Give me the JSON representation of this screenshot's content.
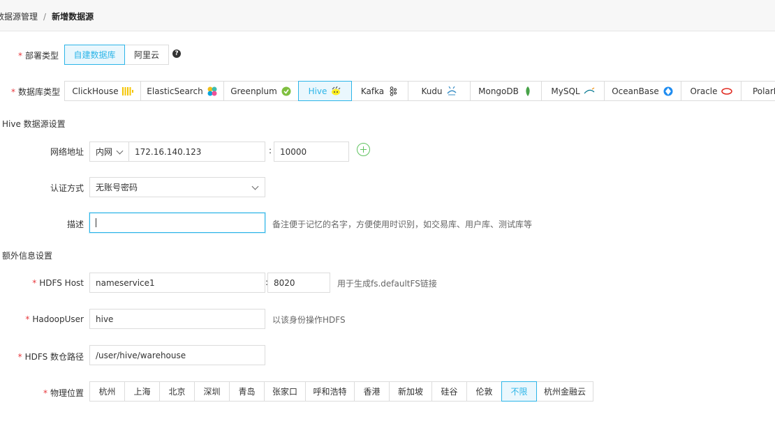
{
  "breadcrumb": {
    "parent": "数据源管理",
    "separator": "/",
    "current": "新增数据源"
  },
  "deploy_type": {
    "label": "部署类型",
    "options": [
      "自建数据库",
      "阿里云"
    ],
    "selected": "自建数据库",
    "help_icon": "question-circle-icon"
  },
  "db_type": {
    "label": "数据库类型",
    "options": [
      {
        "name": "ClickHouse",
        "icon": "clickhouse-icon"
      },
      {
        "name": "ElasticSearch",
        "icon": "elasticsearch-icon"
      },
      {
        "name": "Greenplum",
        "icon": "greenplum-icon"
      },
      {
        "name": "Hive",
        "icon": "hive-icon"
      },
      {
        "name": "Kafka",
        "icon": "kafka-icon"
      },
      {
        "name": "Kudu",
        "icon": "kudu-icon"
      },
      {
        "name": "MongoDB",
        "icon": "mongodb-icon"
      },
      {
        "name": "MySQL",
        "icon": "mysql-icon"
      },
      {
        "name": "OceanBase",
        "icon": "oceanbase-icon"
      },
      {
        "name": "Oracle",
        "icon": "oracle-icon"
      },
      {
        "name": "PolarDB-",
        "icon": ""
      }
    ],
    "selected": "Hive"
  },
  "hive_section": {
    "title": "Hive 数据源设置",
    "network": {
      "label": "网络地址",
      "type": "内网",
      "host": "172.16.140.123",
      "colon": ":",
      "port": "10000",
      "add_icon": "plus-circle-icon"
    },
    "auth": {
      "label": "认证方式",
      "value": "无账号密码"
    },
    "description": {
      "label": "描述",
      "value": "",
      "hint": "备注便于记忆的名字，方便使用时识别，如交易库、用户库、测试库等"
    }
  },
  "extra_section": {
    "title": "额外信息设置",
    "hdfs_host": {
      "label": "HDFS Host",
      "host": "nameservice1",
      "colon": ":",
      "port": "8020",
      "hint": "用于生成fs.defaultFS链接"
    },
    "hadoop_user": {
      "label": "HadoopUser",
      "value": "hive",
      "hint": "以该身份操作HDFS"
    },
    "hdfs_path": {
      "label": "HDFS 数仓路径",
      "value": "/user/hive/warehouse"
    },
    "location": {
      "label": "物理位置",
      "options": [
        "杭州",
        "上海",
        "北京",
        "深圳",
        "青岛",
        "张家口",
        "呼和浩特",
        "香港",
        "新加坡",
        "硅谷",
        "伦敦",
        "不限",
        "杭州金融云"
      ],
      "selected": "不限"
    }
  },
  "colors": {
    "accent": "#2cb5e8",
    "required": "#e8383d",
    "add": "#5fc35f"
  }
}
